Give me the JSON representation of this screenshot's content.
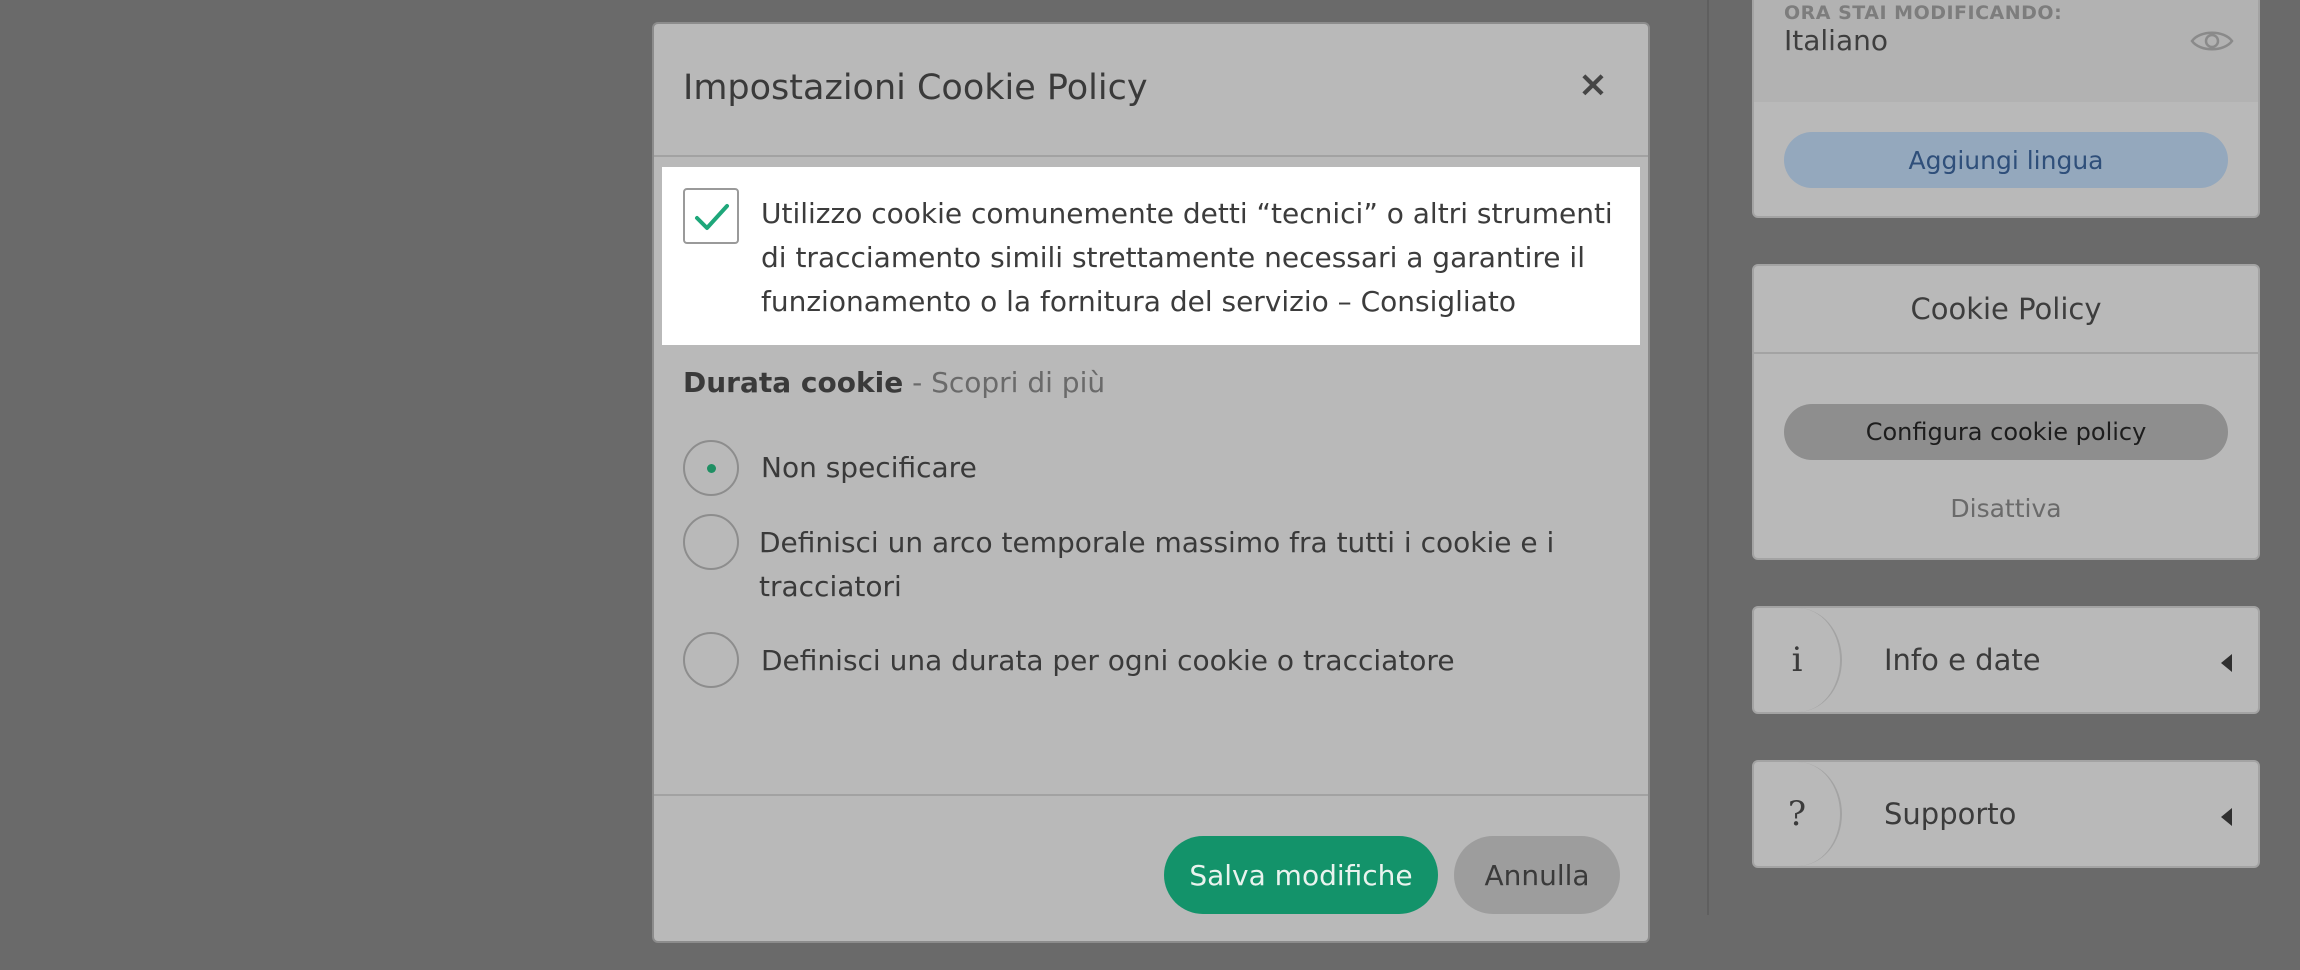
{
  "background_panel": {
    "language_card": {
      "caption": "ORA STAI MODIFICANDO:",
      "current_language": "Italiano",
      "view_icon": "eye-icon",
      "add_language_label": "Aggiungi lingua"
    },
    "cookie_policy_card": {
      "title": "Cookie Policy",
      "configure_label": "Configura cookie policy",
      "deactivate_label": "Disattiva"
    },
    "accordions": [
      {
        "icon": "info-icon",
        "glyph": "i",
        "label": "Info e date"
      },
      {
        "icon": "question-icon",
        "glyph": "?",
        "label": "Supporto"
      }
    ]
  },
  "modal": {
    "title": "Impostazioni Cookie Policy",
    "close_glyph": "×",
    "technical_cookies": {
      "checked": true,
      "text": "Utilizzo cookie comunemente detti “tecnici” o altri strumenti di tracciamento simili strettamente necessari a garantire il funzionamento o la fornitura del servizio – Consigliato"
    },
    "duration": {
      "label": "Durata cookie",
      "separator": " - ",
      "learn_more": "Scopri di più",
      "options": [
        {
          "label": "Non specificare",
          "selected": true
        },
        {
          "label": "Definisci un arco temporale massimo fra tutti i cookie e i tracciatori",
          "selected": false
        },
        {
          "label": "Definisci una durata per ogni cookie o tracciatore",
          "selected": false
        }
      ]
    },
    "footer": {
      "save_label": "Salva modifiche",
      "cancel_label": "Annulla"
    }
  },
  "colors": {
    "accent_green": "#13936a",
    "overlay": "#6a6a6a",
    "link_blue": "#2f4f7a"
  }
}
